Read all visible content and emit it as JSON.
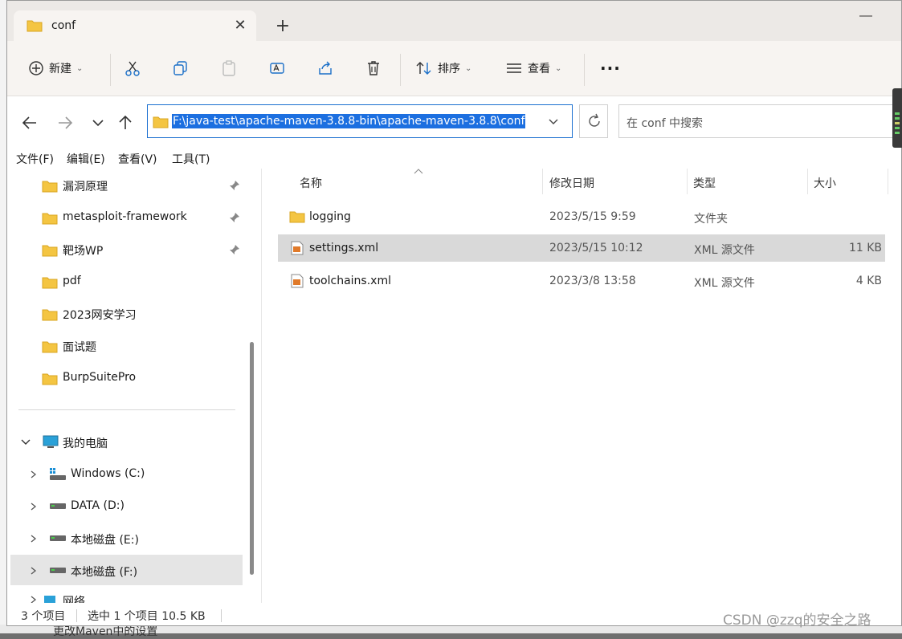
{
  "background": {
    "bottom_text": "更改Maven中的设置"
  },
  "window": {
    "tab": {
      "title": "conf",
      "close_glyph": "✕"
    },
    "new_tab_glyph": "+",
    "toolbar": {
      "new_label": "新建",
      "sort_label": "排序",
      "view_label": "查看",
      "more_glyph": "···"
    },
    "nav": {
      "address": "F:\\java-test\\apache-maven-3.8.8-bin\\apache-maven-3.8.8\\conf",
      "search_placeholder": "在 conf 中搜索"
    },
    "menu": [
      "文件(F)",
      "编辑(E)",
      "查看(V)",
      "工具(T)"
    ],
    "sidebar": {
      "quick_access": [
        {
          "label": "漏洞原理",
          "pinned": true
        },
        {
          "label": "metasploit-framework",
          "pinned": true
        },
        {
          "label": "靶场WP",
          "pinned": true
        },
        {
          "label": "pdf",
          "pinned": false
        },
        {
          "label": "2023网安学习",
          "pinned": false
        },
        {
          "label": "面试题",
          "pinned": false
        },
        {
          "label": "BurpSuitePro",
          "pinned": false
        }
      ],
      "this_pc": "我的电脑",
      "drives": [
        {
          "label": "Windows (C:)"
        },
        {
          "label": "DATA (D:)"
        },
        {
          "label": "本地磁盘 (E:)"
        },
        {
          "label": "本地磁盘 (F:)",
          "selected": true
        }
      ],
      "network": "网络"
    },
    "columns": [
      "名称",
      "修改日期",
      "类型",
      "大小"
    ],
    "files": [
      {
        "name": "logging",
        "modified": "2023/5/15 9:59",
        "type": "文件夹",
        "size": "",
        "icon": "folder-icon"
      },
      {
        "name": "settings.xml",
        "modified": "2023/5/15 10:12",
        "type": "XML 源文件",
        "size": "11 KB",
        "icon": "xml-file-icon",
        "selected": true
      },
      {
        "name": "toolchains.xml",
        "modified": "2023/3/8 13:58",
        "type": "XML 源文件",
        "size": "4 KB",
        "icon": "xml-file-icon"
      }
    ],
    "status": {
      "count": "3 个项目",
      "selection": "选中 1 个项目  10.5 KB"
    }
  },
  "watermark": "CSDN @zzq的安全之路",
  "colors": {
    "folder": "#f4c542",
    "selection": "#1c6fe0",
    "accent_border": "#1a6fd0"
  }
}
